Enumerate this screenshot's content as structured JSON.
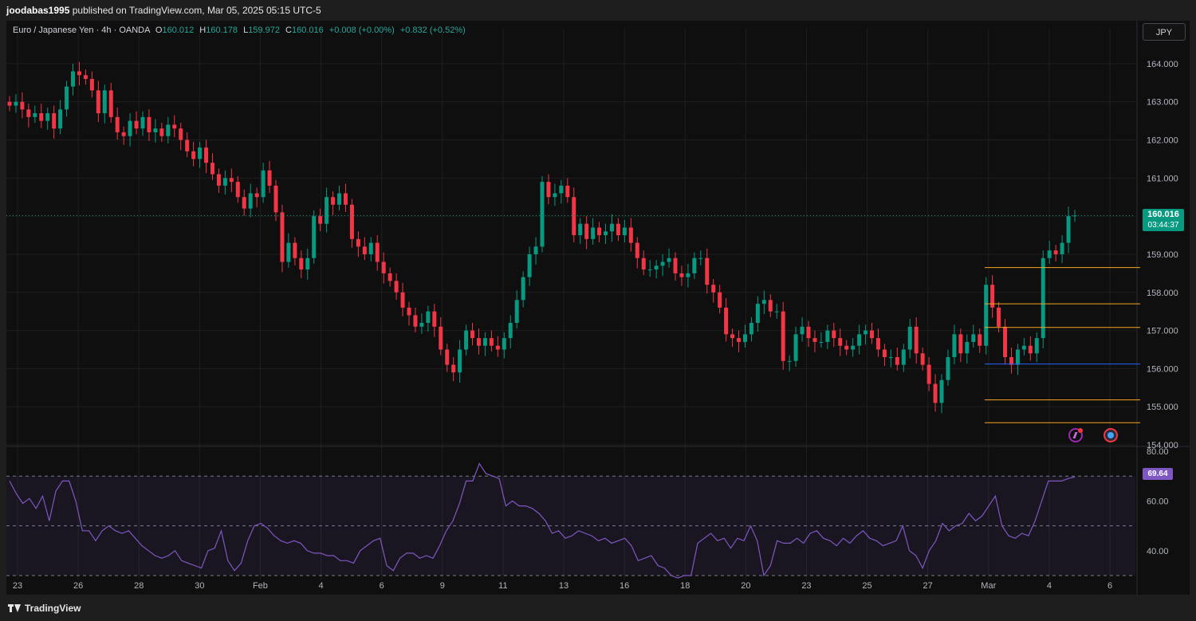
{
  "header": {
    "publisher": "joodabas1995",
    "published_text": "published on TradingView.com, Mar 05, 2025 05:15 UTC-5"
  },
  "legend": {
    "symbol": "Euro / Japanese Yen · 4h · OANDA",
    "o_label": "O",
    "o_value": "160.012",
    "h_label": "H",
    "h_value": "160.178",
    "l_label": "L",
    "l_value": "159.972",
    "c_label": "C",
    "c_value": "160.016",
    "change": "+0.008 (+0.00%)",
    "change2": "+0.832 (+0.52%)"
  },
  "currency_button": "JPY",
  "price_badge": {
    "price": "160.016",
    "countdown": "03:44:37"
  },
  "rsi_badge": "69.64",
  "footer": {
    "brand": "TradingView"
  },
  "colors": {
    "up": "#089981",
    "down": "#f23645",
    "rsi_line": "#7e57c2",
    "level_orange": "#f5a623",
    "level_blue": "#2962ff",
    "grid": "#1f1f1f"
  },
  "chart_data": [
    {
      "type": "candlestick",
      "price_axis": {
        "min": 154.0,
        "max": 164.5,
        "ticks": [
          "164.000",
          "163.000",
          "162.000",
          "161.000",
          "160.000",
          "159.000",
          "158.000",
          "157.000",
          "156.000",
          "155.000",
          "154.000"
        ]
      },
      "x_ticks": [
        "23",
        "26",
        "28",
        "30",
        "Feb",
        "4",
        "6",
        "9",
        "11",
        "13",
        "16",
        "18",
        "20",
        "23",
        "25",
        "27",
        "Mar",
        "4",
        "6"
      ],
      "last_price": 160.016,
      "horizontal_levels": [
        {
          "price": 158.65,
          "color": "orange"
        },
        {
          "price": 157.7,
          "color": "orange"
        },
        {
          "price": 157.08,
          "color": "orange"
        },
        {
          "price": 156.12,
          "color": "blue"
        },
        {
          "price": 155.18,
          "color": "orange"
        },
        {
          "price": 154.58,
          "color": "orange"
        }
      ],
      "closes": [
        162.9,
        163.0,
        162.8,
        162.6,
        162.7,
        162.5,
        162.7,
        162.3,
        162.8,
        163.4,
        163.8,
        163.7,
        163.6,
        163.3,
        162.7,
        163.3,
        162.6,
        162.2,
        162.1,
        162.5,
        162.3,
        162.6,
        162.2,
        162.3,
        162.1,
        162.4,
        162.3,
        162.0,
        161.7,
        161.5,
        161.8,
        161.4,
        161.1,
        160.8,
        161.0,
        160.9,
        160.5,
        160.2,
        160.6,
        160.5,
        161.2,
        160.8,
        160.1,
        158.8,
        159.3,
        158.9,
        158.6,
        158.9,
        160.0,
        159.8,
        160.5,
        160.3,
        160.6,
        160.3,
        159.4,
        159.2,
        159.0,
        159.3,
        158.8,
        158.5,
        158.3,
        158.0,
        157.6,
        157.4,
        157.1,
        157.2,
        157.5,
        157.1,
        156.5,
        156.1,
        155.9,
        156.5,
        157.0,
        156.8,
        156.6,
        156.8,
        156.6,
        156.5,
        156.8,
        157.2,
        157.8,
        158.4,
        159.0,
        159.2,
        160.9,
        160.5,
        160.6,
        160.8,
        160.5,
        159.5,
        159.8,
        159.4,
        159.7,
        159.5,
        159.6,
        159.8,
        159.5,
        159.7,
        159.3,
        158.9,
        158.6,
        158.6,
        158.7,
        158.8,
        158.9,
        158.5,
        158.4,
        158.5,
        158.9,
        158.9,
        158.2,
        158.0,
        157.6,
        156.9,
        156.8,
        156.7,
        156.9,
        157.2,
        157.7,
        157.8,
        157.5,
        157.5,
        156.2,
        156.2,
        156.9,
        157.1,
        156.8,
        156.7,
        156.7,
        157.0,
        156.8,
        156.6,
        156.5,
        156.6,
        156.9,
        157.0,
        156.8,
        156.5,
        156.3,
        156.3,
        156.1,
        156.5,
        157.1,
        156.4,
        156.1,
        155.6,
        155.1,
        155.7,
        156.3,
        156.9,
        156.4,
        156.7,
        156.9,
        156.6,
        158.2,
        157.6,
        157.1,
        156.3,
        156.1,
        156.5,
        156.6,
        156.4,
        156.8,
        158.9,
        159.1,
        159.0,
        159.3,
        160.0,
        160.016
      ]
    },
    {
      "type": "line",
      "name": "RSI",
      "y_axis": {
        "min": 30,
        "max": 80,
        "ticks": [
          "80.00",
          "60.00",
          "40.00"
        ]
      },
      "bands": [
        70,
        50,
        30
      ],
      "last_value": 69.64,
      "values": [
        68,
        63,
        59,
        61,
        57,
        62,
        52,
        64,
        68,
        68,
        60,
        48,
        48,
        44,
        48,
        50,
        48,
        47,
        48,
        45,
        42,
        40,
        38,
        37,
        38,
        40,
        36,
        35,
        34,
        33,
        40,
        41,
        48,
        36,
        32,
        35,
        44,
        50,
        51,
        49,
        46,
        44,
        43,
        44,
        43,
        40,
        39,
        39,
        38,
        38,
        36,
        36,
        35,
        40,
        42,
        44,
        45,
        34,
        32,
        37,
        39,
        39,
        37,
        38,
        37,
        42,
        48,
        52,
        59,
        68,
        68,
        75,
        71,
        70,
        69,
        58,
        60,
        58,
        58,
        57,
        55,
        52,
        47,
        48,
        45,
        46,
        48,
        47,
        46,
        44,
        45,
        43,
        44,
        45,
        42,
        36,
        37,
        38,
        34,
        33,
        30,
        29,
        30,
        30,
        43,
        45,
        47,
        44,
        45,
        41,
        45,
        44,
        50,
        44,
        30,
        34,
        44,
        43,
        43,
        45,
        43,
        47,
        48,
        45,
        44,
        42,
        45,
        43,
        46,
        48,
        45,
        44,
        42,
        43,
        44,
        50,
        40,
        38,
        33,
        40,
        44,
        51,
        48,
        50,
        51,
        55,
        52,
        54,
        58,
        62,
        50,
        46,
        45,
        47,
        46,
        52,
        60,
        68,
        68,
        68,
        69,
        69.64
      ]
    }
  ]
}
